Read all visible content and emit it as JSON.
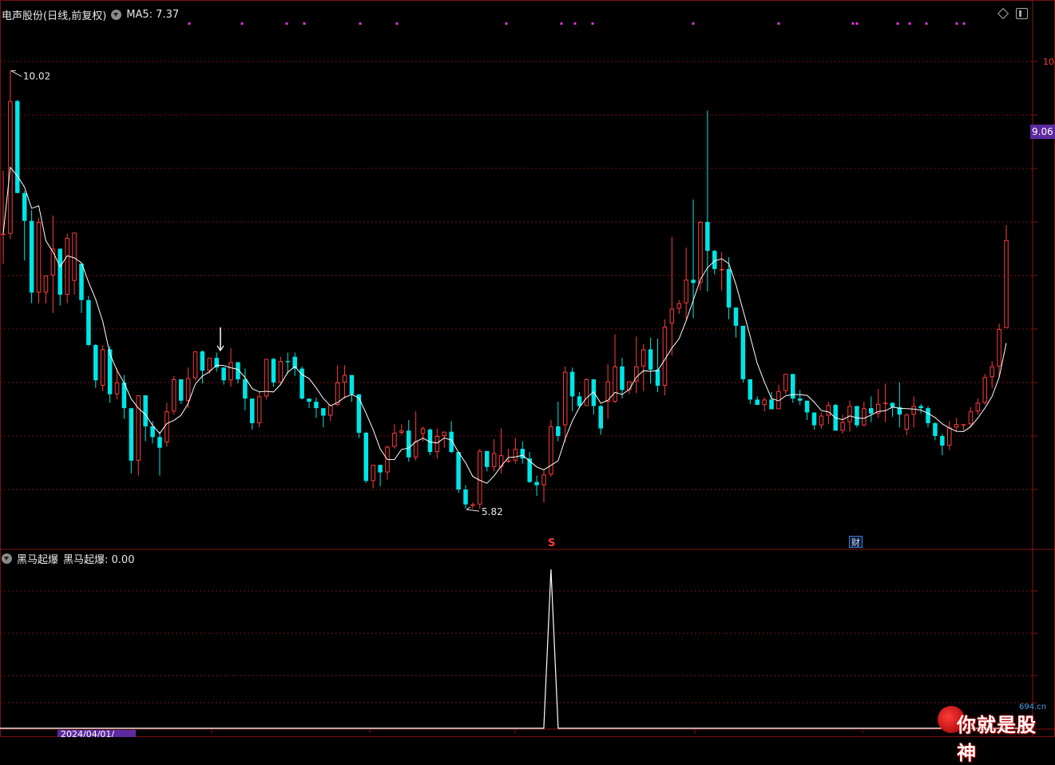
{
  "header": {
    "title": "电声股份(日线,前复权)",
    "ma_label": "MA5: 7.37"
  },
  "indicator": {
    "title": "黑马起爆",
    "value_label": "黑马起爆: 0.00"
  },
  "price_tag": "9.06",
  "date_tag": "2024/04/01/",
  "markers": {
    "s_badge": "S",
    "finance_badge": "财"
  },
  "watermark": {
    "text": "你就是股神",
    "site": "694.cn"
  },
  "colors": {
    "up": "#ff3b3b",
    "down": "#00e5e5",
    "ma": "#ffffff",
    "grid": "#7a1010",
    "marker": "#e033e0"
  },
  "chart_data": [
    {
      "type": "candlestick",
      "title": "电声股份(日线,前复权)",
      "ylim": [
        5.5,
        10.35
      ],
      "y_ticks": [
        10.0,
        9.5,
        9.0,
        8.5,
        8.0,
        7.5,
        7.0,
        6.5,
        6.0
      ],
      "high_label": "10.02",
      "low_label": "5.82",
      "series": [
        {
          "name": "K",
          "ohlc": [
            [
              8.39,
              8.98,
              8.11,
              8.39
            ],
            [
              8.39,
              9.92,
              8.34,
              9.63
            ],
            [
              9.63,
              9.64,
              8.77,
              8.77
            ],
            [
              8.77,
              8.79,
              8.14,
              8.51
            ],
            [
              8.51,
              8.61,
              7.74,
              7.84
            ],
            [
              7.84,
              8.54,
              7.74,
              8.5
            ],
            [
              7.84,
              8.0,
              7.74,
              8.0
            ],
            [
              8.0,
              8.56,
              7.65,
              8.25
            ],
            [
              8.25,
              8.16,
              7.72,
              7.82
            ],
            [
              7.82,
              8.39,
              7.74,
              8.35
            ],
            [
              7.95,
              8.4,
              7.82,
              8.4
            ],
            [
              8.11,
              8.01,
              7.65,
              7.77
            ],
            [
              7.77,
              7.81,
              7.34,
              7.35
            ],
            [
              7.35,
              7.36,
              6.95,
              7.02
            ],
            [
              6.97,
              7.35,
              6.92,
              7.31
            ],
            [
              7.31,
              7.34,
              6.81,
              6.89
            ],
            [
              6.89,
              7.13,
              6.84,
              7.0
            ],
            [
              7.0,
              7.07,
              6.66,
              6.76
            ],
            [
              6.76,
              6.66,
              6.15,
              6.27
            ],
            [
              6.27,
              6.88,
              6.13,
              6.88
            ],
            [
              6.88,
              6.81,
              6.45,
              6.59
            ],
            [
              6.59,
              6.64,
              6.43,
              6.49
            ],
            [
              6.49,
              6.54,
              6.13,
              6.39
            ],
            [
              6.44,
              6.81,
              6.4,
              6.73
            ],
            [
              6.73,
              7.06,
              6.7,
              7.03
            ],
            [
              7.03,
              6.99,
              6.8,
              6.83
            ],
            [
              6.83,
              7.14,
              6.76,
              7.04
            ],
            [
              7.04,
              7.29,
              7.02,
              7.29
            ],
            [
              7.29,
              7.3,
              6.99,
              7.11
            ],
            [
              7.11,
              7.23,
              7.08,
              7.23
            ],
            [
              7.23,
              7.28,
              7.1,
              7.14
            ],
            [
              7.14,
              7.13,
              6.98,
              7.02
            ],
            [
              7.02,
              7.32,
              6.96,
              7.19
            ],
            [
              7.19,
              7.09,
              6.99,
              7.03
            ],
            [
              7.03,
              7.13,
              6.74,
              6.85
            ],
            [
              6.85,
              6.7,
              6.56,
              6.62
            ],
            [
              6.62,
              6.91,
              6.58,
              6.87
            ],
            [
              6.87,
              7.22,
              6.84,
              7.22
            ],
            [
              7.22,
              7.23,
              6.96,
              7.0
            ],
            [
              7.0,
              7.24,
              6.99,
              7.2
            ],
            [
              7.2,
              7.28,
              7.08,
              7.19
            ],
            [
              7.24,
              7.28,
              7.06,
              7.13
            ],
            [
              7.13,
              7.15,
              6.84,
              6.85
            ],
            [
              6.85,
              6.84,
              6.76,
              6.82
            ],
            [
              6.82,
              6.86,
              6.67,
              6.76
            ],
            [
              6.76,
              6.72,
              6.58,
              6.69
            ],
            [
              6.69,
              6.79,
              6.64,
              6.79
            ],
            [
              6.79,
              7.16,
              6.78,
              7.0
            ],
            [
              7.0,
              7.16,
              6.85,
              7.07
            ],
            [
              7.07,
              7.06,
              6.82,
              6.89
            ],
            [
              6.89,
              6.77,
              6.48,
              6.53
            ],
            [
              6.53,
              6.54,
              6.06,
              6.08
            ],
            [
              6.08,
              6.23,
              6.01,
              6.23
            ],
            [
              6.23,
              6.18,
              6.03,
              6.16
            ],
            [
              6.16,
              6.41,
              6.09,
              6.4
            ],
            [
              6.4,
              6.61,
              6.38,
              6.53
            ],
            [
              6.53,
              6.61,
              6.51,
              6.55
            ],
            [
              6.55,
              6.65,
              6.26,
              6.3
            ],
            [
              6.3,
              6.73,
              6.27,
              6.45
            ],
            [
              6.52,
              6.59,
              6.45,
              6.57
            ],
            [
              6.56,
              6.57,
              6.32,
              6.35
            ],
            [
              6.35,
              6.57,
              6.29,
              6.5
            ],
            [
              6.5,
              6.54,
              6.39,
              6.54
            ],
            [
              6.54,
              6.64,
              6.34,
              6.35
            ],
            [
              6.35,
              6.35,
              5.97,
              6.0
            ],
            [
              6.0,
              6.04,
              5.82,
              5.86
            ],
            [
              5.86,
              5.88,
              5.82,
              5.86
            ],
            [
              5.86,
              6.38,
              5.82,
              6.36
            ],
            [
              6.36,
              6.35,
              6.17,
              6.21
            ],
            [
              6.21,
              6.47,
              6.17,
              6.34
            ],
            [
              6.21,
              6.57,
              6.15,
              6.32
            ],
            [
              6.27,
              6.38,
              6.25,
              6.27
            ],
            [
              6.27,
              6.48,
              6.24,
              6.38
            ],
            [
              6.38,
              6.45,
              6.24,
              6.29
            ],
            [
              6.29,
              6.35,
              6.06,
              6.07
            ],
            [
              6.07,
              6.13,
              5.94,
              6.04
            ],
            [
              6.04,
              6.18,
              5.88,
              6.14
            ],
            [
              6.14,
              6.65,
              6.12,
              6.59
            ],
            [
              6.59,
              6.82,
              6.45,
              6.5
            ],
            [
              6.6,
              7.15,
              6.44,
              7.1
            ],
            [
              7.1,
              7.14,
              6.73,
              6.87
            ],
            [
              6.87,
              6.91,
              6.76,
              6.78
            ],
            [
              6.78,
              7.04,
              6.78,
              7.03
            ],
            [
              7.03,
              6.97,
              6.7,
              6.78
            ],
            [
              6.78,
              6.79,
              6.51,
              6.57
            ],
            [
              6.82,
              7.17,
              6.66,
              7.01
            ],
            [
              6.82,
              7.45,
              6.81,
              7.15
            ],
            [
              7.15,
              7.23,
              6.85,
              6.93
            ],
            [
              6.93,
              7.01,
              6.89,
              7.01
            ],
            [
              7.01,
              7.43,
              6.9,
              7.15
            ],
            [
              7.15,
              7.36,
              6.92,
              7.31
            ],
            [
              7.31,
              7.42,
              6.99,
              7.12
            ],
            [
              7.12,
              7.41,
              6.91,
              6.97
            ],
            [
              6.97,
              7.59,
              6.88,
              7.52
            ],
            [
              7.55,
              8.36,
              7.25,
              7.69
            ],
            [
              7.69,
              7.77,
              7.64,
              7.74
            ],
            [
              7.74,
              8.26,
              7.59,
              7.96
            ],
            [
              7.96,
              8.71,
              7.6,
              7.93
            ],
            [
              7.93,
              8.51,
              7.86,
              8.5
            ],
            [
              8.5,
              9.54,
              7.85,
              8.23
            ],
            [
              8.23,
              8.24,
              8.01,
              8.06
            ],
            [
              8.06,
              8.22,
              7.86,
              8.06
            ],
            [
              8.06,
              8.17,
              7.59,
              7.7
            ],
            [
              7.7,
              7.59,
              7.42,
              7.53
            ],
            [
              7.53,
              7.49,
              7.0,
              7.03
            ],
            [
              7.03,
              6.92,
              6.8,
              6.84
            ],
            [
              6.84,
              6.87,
              6.79,
              6.79
            ],
            [
              6.79,
              6.86,
              6.73,
              6.84
            ],
            [
              6.84,
              6.91,
              6.75,
              6.75
            ],
            [
              6.75,
              6.98,
              6.75,
              6.92
            ],
            [
              6.92,
              7.08,
              6.89,
              7.08
            ],
            [
              7.08,
              7.04,
              6.81,
              6.85
            ],
            [
              6.85,
              6.93,
              6.79,
              6.83
            ],
            [
              6.83,
              6.81,
              6.65,
              6.72
            ],
            [
              6.72,
              6.7,
              6.56,
              6.6
            ],
            [
              6.6,
              6.72,
              6.57,
              6.69
            ],
            [
              6.69,
              6.82,
              6.61,
              6.79
            ],
            [
              6.79,
              6.8,
              6.58,
              6.55
            ],
            [
              6.55,
              6.7,
              6.52,
              6.63
            ],
            [
              6.63,
              6.83,
              6.54,
              6.78
            ],
            [
              6.78,
              6.72,
              6.58,
              6.6
            ],
            [
              6.6,
              6.82,
              6.59,
              6.76
            ],
            [
              6.76,
              6.87,
              6.63,
              6.71
            ],
            [
              6.71,
              6.94,
              6.67,
              6.8
            ],
            [
              6.8,
              6.99,
              6.63,
              6.81
            ],
            [
              6.81,
              6.79,
              6.68,
              6.77
            ],
            [
              6.77,
              7.0,
              6.58,
              6.7
            ],
            [
              6.56,
              6.71,
              6.51,
              6.7
            ],
            [
              6.7,
              6.87,
              6.58,
              6.78
            ],
            [
              6.78,
              6.8,
              6.71,
              6.76
            ],
            [
              6.76,
              6.78,
              6.58,
              6.62
            ],
            [
              6.62,
              6.63,
              6.46,
              6.5
            ],
            [
              6.5,
              6.52,
              6.32,
              6.41
            ],
            [
              6.41,
              6.64,
              6.37,
              6.58
            ],
            [
              6.58,
              6.67,
              6.54,
              6.61
            ],
            [
              6.61,
              6.61,
              6.55,
              6.61
            ],
            [
              6.61,
              6.77,
              6.58,
              6.73
            ],
            [
              6.73,
              6.85,
              6.7,
              6.81
            ],
            [
              6.81,
              7.08,
              6.79,
              7.05
            ],
            [
              7.05,
              7.2,
              6.95,
              7.15
            ],
            [
              7.15,
              7.55,
              7.05,
              7.5
            ],
            [
              7.51,
              8.47,
              7.53,
              8.33
            ]
          ]
        },
        {
          "name": "MA5",
          "value": 7.37
        }
      ]
    },
    {
      "type": "line",
      "title": "黑马起爆",
      "ylim": [
        0,
        1
      ],
      "series": [
        {
          "name": "黑马起爆",
          "spike_at_index": 77,
          "value": 0.0
        }
      ]
    }
  ]
}
